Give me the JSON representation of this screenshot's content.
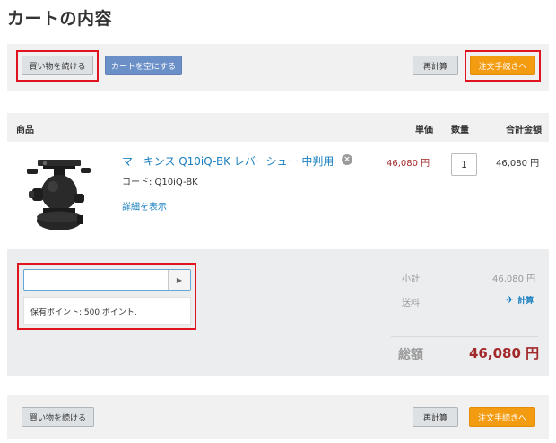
{
  "page": {
    "title": "カートの内容"
  },
  "actions": {
    "continue_shopping": "買い物を続ける",
    "empty_cart": "カートを空にする",
    "recalculate": "再計算",
    "checkout": "注文手続きへ"
  },
  "table": {
    "headers": {
      "product": "商品",
      "unit_price": "単価",
      "quantity": "数量",
      "total": "合計金額"
    }
  },
  "cart_item": {
    "name": "マーキンス Q10iQ-BK レバーシュー 中判用",
    "code": "コード: Q10iQ-BK",
    "details_link": "詳細を表示",
    "unit_price": "46,080 円",
    "quantity": "1",
    "line_total": "46,080 円",
    "remove_glyph": "×"
  },
  "coupon": {
    "value": "",
    "submit_glyph": "▶",
    "points_text": "保有ポイント: 500 ポイント."
  },
  "summary": {
    "subtotal_label": "小計",
    "subtotal_value": "46,080 円",
    "shipping_label": "送料",
    "shipping_link": "計算",
    "total_label": "総額",
    "total_value": "46,080 円"
  },
  "colors": {
    "accent_orange": "#f39c12",
    "price_red": "#a2282a",
    "link_blue": "#1a7fc1",
    "highlight_red": "#e0141e"
  },
  "icons": {
    "remove": "close-circle-icon",
    "submit": "play-arrow-icon",
    "shipping": "airplane-icon"
  }
}
